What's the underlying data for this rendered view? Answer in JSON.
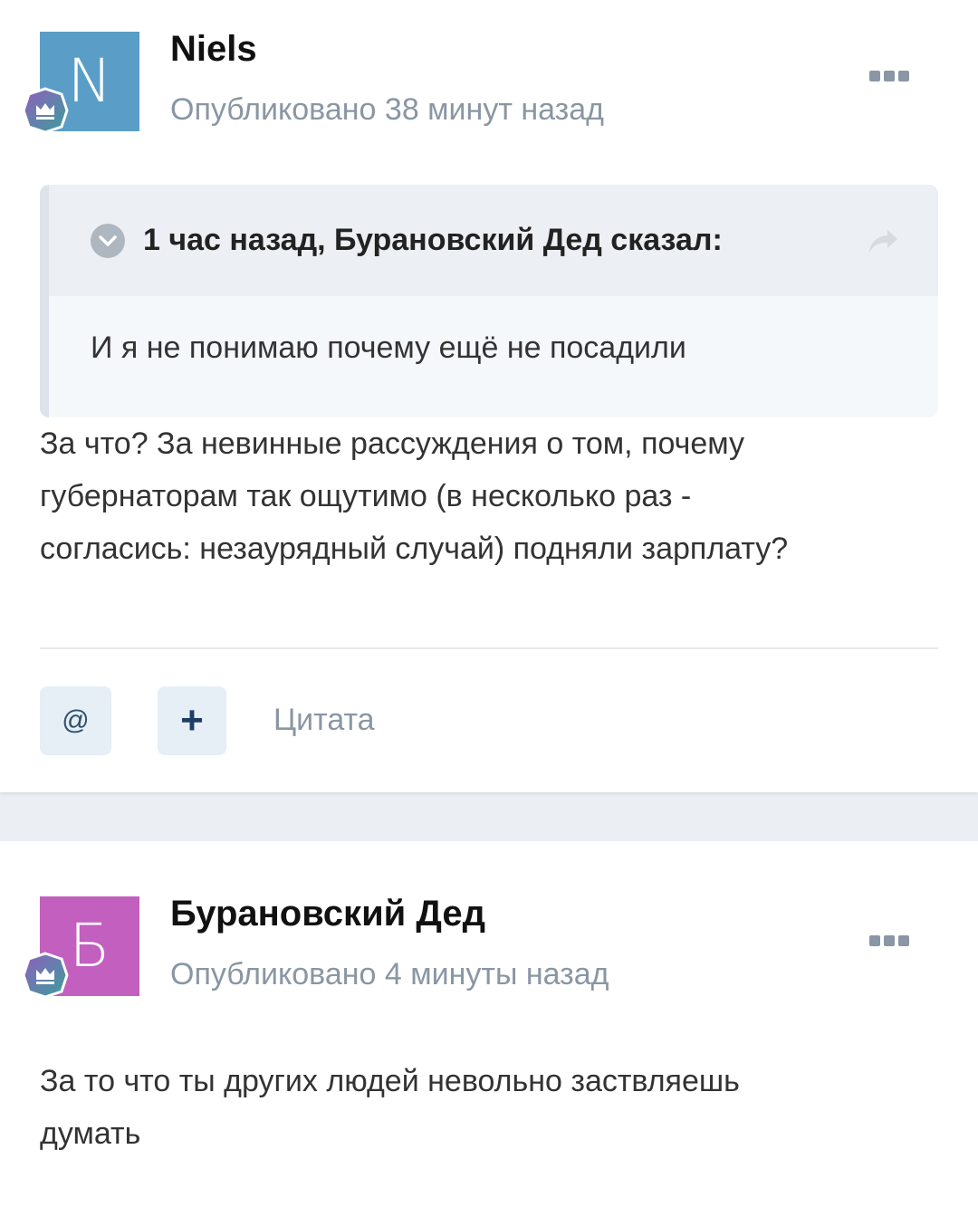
{
  "posts": [
    {
      "avatar_letter": "N",
      "author": "Niels",
      "meta": "Опубликовано 38 минут назад",
      "quote": {
        "title": "1 час назад, Бурановский Дед сказал:",
        "text": "И  я не понимаю почему ещё не посадили"
      },
      "text_lines": [
        "За что? За невинные рассуждения о том, почему",
        "губернаторам так ощутимо (в несколько раз -",
        "согласись: незаурядный случай) подняли зарплату?"
      ],
      "actions": {
        "mention": "@",
        "plus": "+",
        "quote": "Цитата"
      }
    },
    {
      "avatar_letter": "Б",
      "author": "Бурановский Дед",
      "meta": "Опубликовано 4 минуты назад",
      "text_lines": [
        "За то что ты других людей невольно заствляешь",
        "думать"
      ]
    }
  ],
  "icons": {
    "badge": "crown-badge-icon",
    "more": "more-options-icon",
    "quote_toggle": "chevron-down-icon",
    "quote_share": "share-arrow-icon"
  },
  "colors": {
    "avatar_n": "#5a9ec7",
    "avatar_b": "#c25fbf",
    "meta_text": "#8a96a3",
    "page_separator": "#ebeef3"
  }
}
